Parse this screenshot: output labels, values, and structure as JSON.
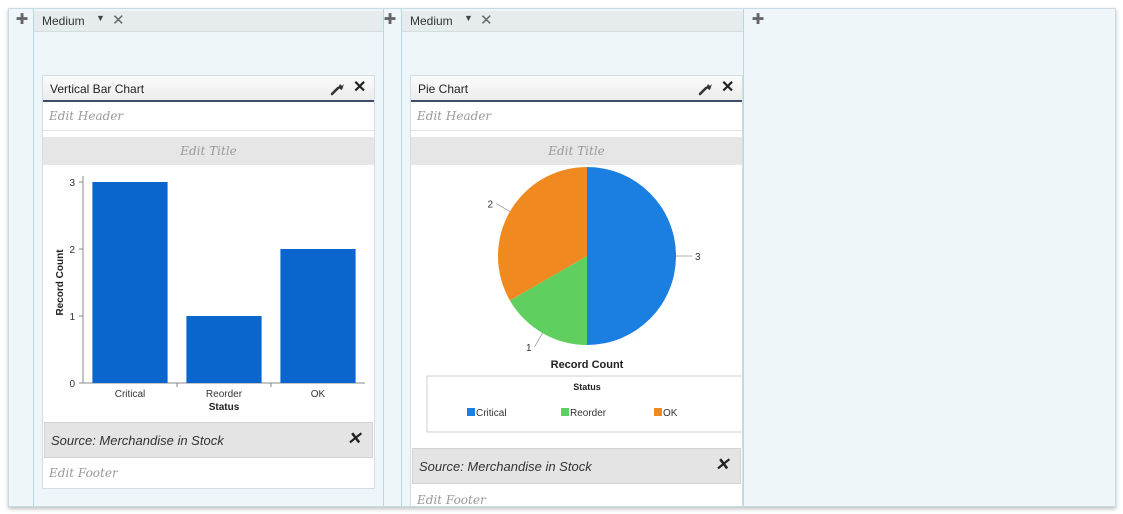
{
  "columns": [
    {
      "size_label": "Medium"
    },
    {
      "size_label": "Medium"
    }
  ],
  "icons": {
    "add": "plus-icon",
    "remove": "close-icon",
    "configure": "wrench-icon",
    "dropdown": "caret-down-icon"
  },
  "bar_panel": {
    "title": "Vertical Bar Chart",
    "edit_header": "Edit Header",
    "edit_title": "Edit Title",
    "source": "Source: Merchandise in Stock",
    "edit_footer": "Edit Footer"
  },
  "pie_panel": {
    "title": "Pie Chart",
    "edit_header": "Edit Header",
    "edit_title": "Edit Title",
    "source": "Source: Merchandise in Stock",
    "edit_footer": "Edit Footer"
  },
  "chart_data": [
    {
      "type": "bar",
      "categories": [
        "Critical",
        "Reorder",
        "OK"
      ],
      "values": [
        3,
        1,
        2
      ],
      "xlabel": "Status",
      "ylabel": "Record Count",
      "yticks": [
        "0",
        "1",
        "2",
        "3"
      ],
      "ylim": [
        0,
        3
      ],
      "color": "#0a66cc"
    },
    {
      "type": "pie",
      "categories": [
        "Critical",
        "Reorder",
        "OK"
      ],
      "values": [
        3,
        1,
        2
      ],
      "value_labels": [
        "3",
        "1",
        "2"
      ],
      "label": "Record Count",
      "legend_title": "Status",
      "colors": [
        "#1a7fe0",
        "#5fcf5f",
        "#f08a20"
      ],
      "legend_placement": "bottom"
    }
  ]
}
